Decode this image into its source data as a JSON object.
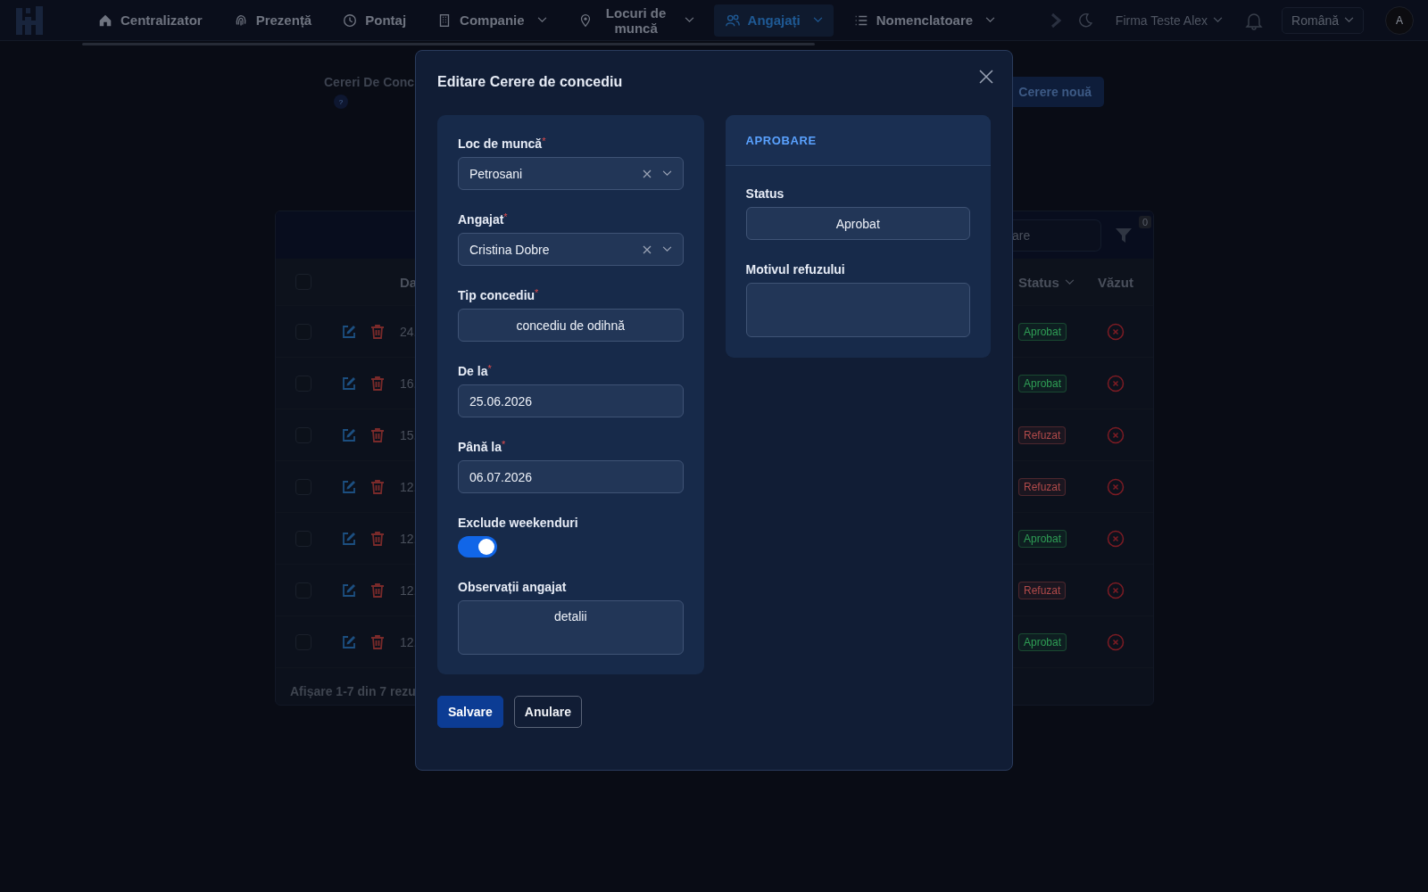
{
  "nav": {
    "items": [
      {
        "label": "Centralizator",
        "selected": false,
        "dropdown": false
      },
      {
        "label": "Prezență",
        "selected": false,
        "dropdown": false
      },
      {
        "label": "Pontaj",
        "selected": false,
        "dropdown": false
      },
      {
        "label": "Companie",
        "selected": false,
        "dropdown": true
      },
      {
        "label": "Locuri de muncă",
        "selected": false,
        "dropdown": true
      },
      {
        "label": "Angajați",
        "selected": true,
        "dropdown": true
      },
      {
        "label": "Nomenclatoare",
        "selected": false,
        "dropdown": true
      }
    ],
    "company": "Firma Teste Alex",
    "language": "Română",
    "avatar": "A"
  },
  "page": {
    "title": "Cereri De Conc",
    "help": "?",
    "new_button": "Cerere nouă"
  },
  "table": {
    "header_checked": false,
    "search_placeholder": "are",
    "filter_count": "0",
    "columns": [
      "Da",
      "Status",
      "Văzut"
    ],
    "rows": [
      {
        "checked": false,
        "date": "24.",
        "status": "Aprobat",
        "color": "#2f9e55",
        "seen": false
      },
      {
        "checked": false,
        "date": "16.",
        "status": "Aprobat",
        "color": "#2f9e55",
        "seen": false
      },
      {
        "checked": false,
        "date": "15.",
        "status": "Refuzat",
        "color": "#b04a4a",
        "seen": false
      },
      {
        "checked": false,
        "date": "12.",
        "status": "Refuzat",
        "color": "#b04a4a",
        "seen": false
      },
      {
        "checked": false,
        "date": "12.",
        "status": "Aprobat",
        "color": "#2f9e55",
        "seen": false
      },
      {
        "checked": false,
        "date": "12.",
        "status": "Refuzat",
        "color": "#b04a4a",
        "seen": false
      },
      {
        "checked": false,
        "date": "12.",
        "status": "Aprobat",
        "color": "#2f9e55",
        "seen": false
      }
    ],
    "footer": "Afișare 1-7 din 7 rezu"
  },
  "modal": {
    "title": "Editare Cerere de concediu",
    "form": [
      {
        "kind": "select",
        "label": "Loc de muncă",
        "required_mark": "*",
        "value": "Petrosani"
      },
      {
        "kind": "select",
        "label": "Angajat",
        "required_mark": "*",
        "value": "Cristina Dobre"
      },
      {
        "kind": "choice",
        "label": "Tip concediu",
        "required_mark": "*",
        "value": "concediu de odihnă"
      },
      {
        "kind": "input",
        "label": "De la",
        "required_mark": "*",
        "value": "25.06.2026"
      },
      {
        "kind": "input",
        "label": "Până la",
        "required_mark": "*",
        "value": "06.07.2026"
      },
      {
        "kind": "toggle",
        "label": "Exclude weekenduri",
        "on": true
      },
      {
        "kind": "textarea",
        "label": "Observații angajat",
        "value": "detalii"
      }
    ],
    "approval": {
      "heading": "APROBARE",
      "fields": [
        {
          "kind": "choice",
          "label": "Status",
          "value": "Aprobat"
        },
        {
          "kind": "textarea",
          "label": "Motivul refuzului"
        }
      ]
    },
    "buttons": [
      {
        "label": "Salvare",
        "kind": "primary"
      },
      {
        "label": "Anulare",
        "kind": "secondary"
      }
    ]
  }
}
